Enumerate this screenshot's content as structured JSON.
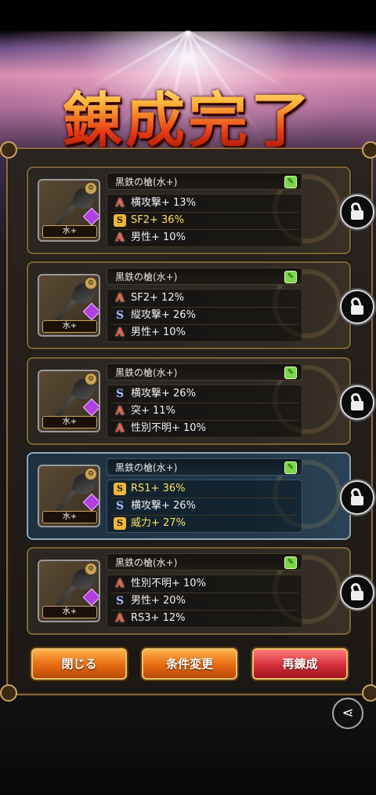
{
  "title": "錬成完了",
  "items": [
    {
      "name": "黒鉄の槍(水+)",
      "element": "水+",
      "stats": [
        {
          "icon": "A",
          "text": "横攻撃+ 13%",
          "gold": false
        },
        {
          "icon": "SS",
          "text": "SF2+ 36%",
          "gold": true
        },
        {
          "icon": "A",
          "text": "男性+ 10%",
          "gold": false
        }
      ]
    },
    {
      "name": "黒鉄の槍(水+)",
      "element": "水+",
      "stats": [
        {
          "icon": "A",
          "text": "SF2+ 12%",
          "gold": false
        },
        {
          "icon": "S",
          "text": "縦攻撃+ 26%",
          "gold": false
        },
        {
          "icon": "A",
          "text": "男性+ 10%",
          "gold": false
        }
      ]
    },
    {
      "name": "黒鉄の槍(水+)",
      "element": "水+",
      "stats": [
        {
          "icon": "S",
          "text": "横攻撃+ 26%",
          "gold": false
        },
        {
          "icon": "A",
          "text": "突+ 11%",
          "gold": false
        },
        {
          "icon": "A",
          "text": "性別不明+ 10%",
          "gold": false
        }
      ]
    },
    {
      "name": "黒鉄の槍(水+)",
      "element": "水+",
      "highlight": true,
      "stats": [
        {
          "icon": "SS",
          "text": "RS1+ 36%",
          "gold": true
        },
        {
          "icon": "S",
          "text": "横攻撃+ 26%",
          "gold": false
        },
        {
          "icon": "SS",
          "text": "威力+ 27%",
          "gold": true
        }
      ]
    },
    {
      "name": "黒鉄の槍(水+)",
      "element": "水+",
      "stats": [
        {
          "icon": "A",
          "text": "性別不明+ 10%",
          "gold": false
        },
        {
          "icon": "S",
          "text": "男性+ 20%",
          "gold": false
        },
        {
          "icon": "A",
          "text": "RS3+ 12%",
          "gold": false
        }
      ]
    }
  ],
  "buttons": {
    "close": "閉じる",
    "change": "条件変更",
    "reforge": "再錬成"
  },
  "icons": {
    "grade_a": "A",
    "grade_s": "S",
    "grade_ss": "SS"
  }
}
